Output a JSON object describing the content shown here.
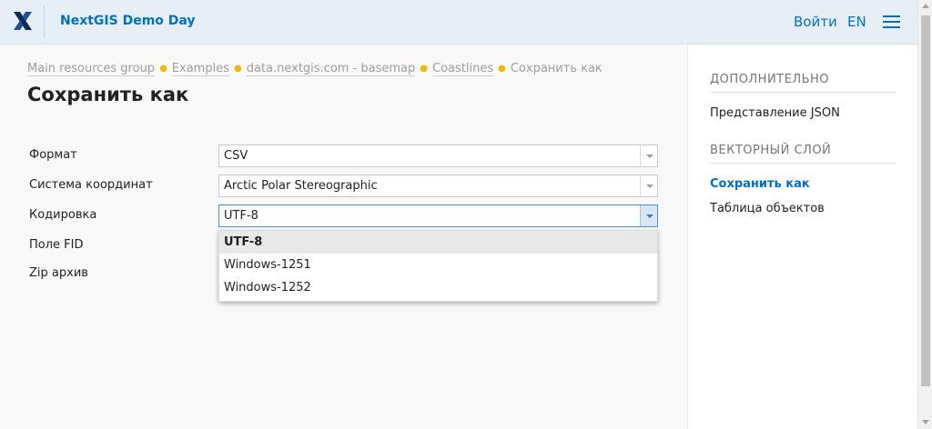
{
  "header": {
    "app_title": "NextGIS Demo Day",
    "login_label": "Войти",
    "lang_label": "EN",
    "logo_icon": "nextgis-x-logo",
    "menu_icon": "hamburger-menu-icon"
  },
  "breadcrumbs": [
    "Main resources group",
    "Examples",
    "data.nextgis.com - basemap",
    "Coastlines",
    "Сохранить как"
  ],
  "page": {
    "title": "Сохранить как"
  },
  "form": {
    "format_label": "Формат",
    "format_value": "CSV",
    "srs_label": "Система координат",
    "srs_value": "Arctic Polar Stereographic",
    "encoding_label": "Кодировка",
    "encoding_value": "UTF-8",
    "fid_label": "Поле FID",
    "zip_label": "Zip архив"
  },
  "encoding_dropdown": {
    "options": [
      "UTF-8",
      "Windows-1251",
      "Windows-1252"
    ],
    "selected": "UTF-8"
  },
  "sidebar": {
    "section1_heading": "ДОПОЛНИТЕЛЬНО",
    "json_link": "Представление JSON",
    "section2_heading": "ВЕКТОРНЫЙ СЛОЙ",
    "save_as_link": "Сохранить как",
    "feature_table_link": "Таблица объектов"
  },
  "colors": {
    "accent": "#0070c5",
    "header_bg": "#e6eef6",
    "breadcrumb_separator": "#f5b800"
  }
}
